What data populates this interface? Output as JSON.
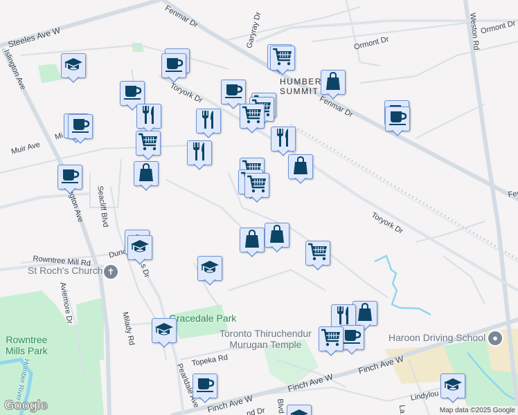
{
  "map": {
    "roads": {
      "steeles": "Steeles Ave W",
      "fenmar_1": "Fenmar Dr",
      "fenmar_2": "Fenmar Dr",
      "fenmar_3": "Fen",
      "garyray": "Garyray Dr",
      "ormont_1": "Ormont Dr",
      "ormont_2": "Ormont Dr",
      "weston": "Weston Rd",
      "islington_1": "Islington Ave",
      "islington_2": "Islington Ave",
      "toryork_1": "Toryork Dr",
      "toryork_2": "Toryork Dr",
      "muir": "Muir Ave",
      "mi": "Mi",
      "seacliff": "Seacliff Blvd",
      "rowntree_mill": "Rowntree Mill Rd",
      "dunc": "Dunc",
      "s_dr": "s Dr",
      "aviemore": "Aviemore Dr",
      "milady": "Milady Rd",
      "topeka": "Topeka Rd",
      "pearldale": "Pearldale Ave",
      "finch_1": "Finch Ave W",
      "finch_2": "Finch Ave W",
      "finch_3": "Finch Ave W",
      "lindylou": "Lindylou R",
      "nd_dr": "nd Dr",
      "blvd": "Blvd",
      "la": "La"
    },
    "places": {
      "humber_summit": "HUMBER\nSUMMIT",
      "st_roch": "St Roch's Church",
      "gracedale": "Gracedale Park",
      "temple": "Toronto Thiruchendur\nMurugan Temple",
      "haroon": "Haroon Driving School",
      "rowntree_park": "Rowntree\nMills Park",
      "humber_river": "Humber River"
    },
    "markers": [
      {
        "icon": "school-icon"
      },
      {
        "icon": "coffee-icon"
      },
      {
        "icon": "coffee-icon"
      },
      {
        "icon": "coffee-icon"
      },
      {
        "icon": "restaurant-icon"
      },
      {
        "icon": "coffee-icon"
      },
      {
        "icon": "coffee-icon"
      },
      {
        "icon": "shopping-cart-icon"
      },
      {
        "icon": "shopping-bag-icon"
      },
      {
        "icon": "coffee-icon"
      },
      {
        "icon": "restaurant-icon"
      },
      {
        "icon": "restaurant-icon"
      },
      {
        "icon": "coffee-icon"
      },
      {
        "icon": "shopping-cart-icon"
      },
      {
        "icon": "shopping-cart-icon"
      },
      {
        "icon": "shopping-cart-icon"
      },
      {
        "icon": "shopping-cart-icon"
      },
      {
        "icon": "shopping-cart-icon"
      },
      {
        "icon": "shopping-bag-icon"
      },
      {
        "icon": "restaurant-icon"
      },
      {
        "icon": "shopping-bag-icon"
      },
      {
        "icon": "shopping-cart-icon"
      },
      {
        "icon": "shopping-cart-icon"
      },
      {
        "icon": "shopping-cart-icon"
      },
      {
        "icon": "coffee-icon"
      },
      {
        "icon": "coffee-icon"
      },
      {
        "icon": "shopping-bag-icon"
      },
      {
        "icon": "shopping-bag-icon"
      },
      {
        "icon": "shopping-cart-icon"
      },
      {
        "icon": "school-icon"
      },
      {
        "icon": "school-icon"
      },
      {
        "icon": "school-icon"
      },
      {
        "icon": "school-icon"
      },
      {
        "icon": "coffee-icon"
      },
      {
        "icon": "shopping-bag-icon"
      },
      {
        "icon": "restaurant-icon"
      },
      {
        "icon": "coffee-icon"
      },
      {
        "icon": "shopping-cart-icon"
      },
      {
        "icon": "school-icon"
      },
      {
        "icon": "school-icon"
      }
    ],
    "logo": "Google",
    "attribution": "Map data ©2025 Google"
  },
  "colors": {
    "marker_fill": "#dfe9fb",
    "marker_border": "#6c93d8",
    "icon": "#0d4466",
    "park": "#c8efd4",
    "water": "#8fd7ec"
  }
}
